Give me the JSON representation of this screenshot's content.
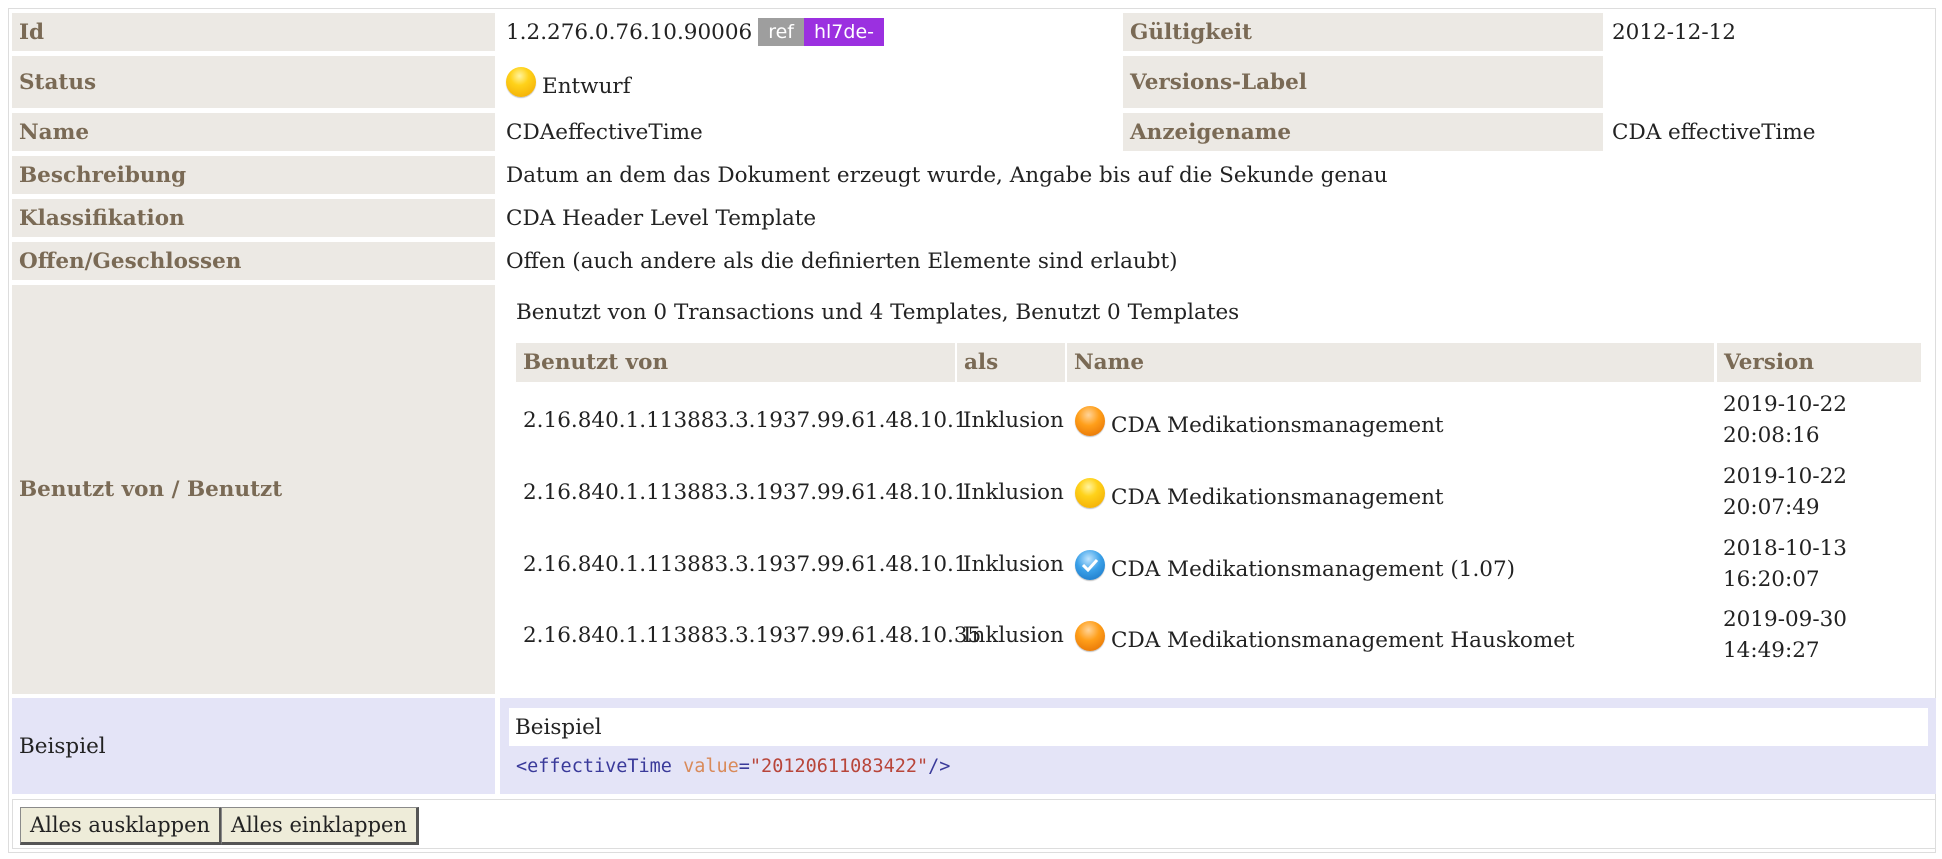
{
  "rows": {
    "id": {
      "label": "Id",
      "value": "1.2.276.0.76.10.90006",
      "badge_ref": "ref",
      "badge_prefix": "hl7de-"
    },
    "validity": {
      "label": "Gültigkeit",
      "value": "2012-12-12"
    },
    "status": {
      "label": "Status",
      "value": "Entwurf",
      "icon": "status-draft-yellow"
    },
    "version_label": {
      "label": "Versions-Label",
      "value": ""
    },
    "name": {
      "label": "Name",
      "value": "CDAeffectiveTime"
    },
    "display_name": {
      "label": "Anzeigename",
      "value": "CDA effectiveTime"
    },
    "description": {
      "label": "Beschreibung",
      "value": "Datum an dem das Dokument erzeugt wurde, Angabe bis auf die Sekunde genau"
    },
    "classification": {
      "label": "Klassifikation",
      "value": "CDA Header Level Template"
    },
    "open_closed": {
      "label": "Offen/Geschlossen",
      "value": "Offen (auch andere als die definierten Elemente sind erlaubt)"
    },
    "used_by": {
      "label": "Benutzt von / Benutzt",
      "summary": "Benutzt von 0 Transactions und 4 Templates, Benutzt 0 Templates",
      "columns": [
        "Benutzt von",
        "als",
        "Name",
        "Version"
      ],
      "items": [
        {
          "oid": "2.16.840.1.113883.3.1937.99.61.48.10.1",
          "as": "Inklusion",
          "status_icon": "orange",
          "name": "CDA Medikationsmanagement",
          "version_date": "2019-10-22",
          "version_time": "20:08:16"
        },
        {
          "oid": "2.16.840.1.113883.3.1937.99.61.48.10.1",
          "as": "Inklusion",
          "status_icon": "yellow",
          "name": "CDA Medikationsmanagement",
          "version_date": "2019-10-22",
          "version_time": "20:07:49"
        },
        {
          "oid": "2.16.840.1.113883.3.1937.99.61.48.10.1",
          "as": "Inklusion",
          "status_icon": "blue-check",
          "name": "CDA Medikationsmanagement (1.07)",
          "version_date": "2018-10-13",
          "version_time": "16:20:07"
        },
        {
          "oid": "2.16.840.1.113883.3.1937.99.61.48.10.35",
          "as": "Inklusion",
          "status_icon": "orange",
          "name": "CDA Medikationsmanagement Hauskomet",
          "version_date": "2019-09-30",
          "version_time": "14:49:27"
        }
      ]
    },
    "example": {
      "label": "Beispiel",
      "title": "Beispiel",
      "code_open": "<effectiveTime ",
      "code_attr": "value",
      "code_eq": "=",
      "code_str": "\"20120611083422\"",
      "code_close": "/>"
    }
  },
  "buttons": {
    "expand_all": "Alles ausklappen",
    "collapse_all": "Alles einklappen"
  },
  "colors": {
    "label_bg": "#ece9e4",
    "label_text": "#7a6a55",
    "example_bg": "#e4e4f7",
    "badge_ref": "#9e9e9e",
    "badge_hl7": "#9b30e0"
  }
}
